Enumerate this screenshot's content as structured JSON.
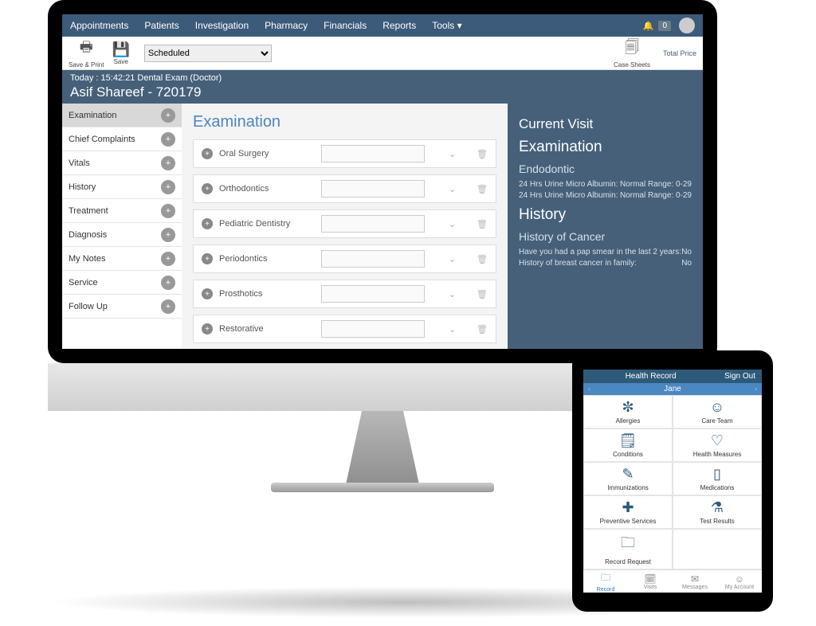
{
  "topnav": {
    "items": [
      "Appointments",
      "Patients",
      "Investigation",
      "Pharmacy",
      "Financials",
      "Reports",
      "Tools ▾"
    ],
    "notif_count": "0"
  },
  "toolbar": {
    "save_print": "Save & Print",
    "save": "Save",
    "status_value": "Scheduled",
    "case_sheets": "Case Sheets",
    "total_price_label": "Total Price"
  },
  "context": {
    "today_line": "Today : 15:42:21   Dental Exam (Doctor)",
    "patient": "Asif Shareef - 720179"
  },
  "sidebar": {
    "items": [
      {
        "label": "Examination",
        "active": true
      },
      {
        "label": "Chief Complaints"
      },
      {
        "label": "Vitals"
      },
      {
        "label": "History"
      },
      {
        "label": "Treatment"
      },
      {
        "label": "Diagnosis"
      },
      {
        "label": "My Notes"
      },
      {
        "label": "Service"
      },
      {
        "label": "Follow Up"
      }
    ]
  },
  "center": {
    "title": "Examination",
    "rows": [
      {
        "label": "Oral Surgery"
      },
      {
        "label": "Orthodontics"
      },
      {
        "label": "Pediatric Dentistry"
      },
      {
        "label": "Periodontics"
      },
      {
        "label": "Prosthotics"
      },
      {
        "label": "Restorative"
      }
    ]
  },
  "right": {
    "current_visit": "Current Visit",
    "examination": "Examination",
    "endo": "Endodontic",
    "endo_rows": [
      {
        "k": "24 Hrs Urine Micro Albumin:",
        "v": "Normal Range: 0-29"
      },
      {
        "k": "24 Hrs Urine Micro Albumin:",
        "v": "Normal Range: 0-29"
      }
    ],
    "history": "History",
    "cancer": "History of Cancer",
    "cancer_rows": [
      {
        "k": "Have you had a pap smear in the last 2 years:",
        "v": "No"
      },
      {
        "k": "History of breast cancer in family:",
        "v": "No"
      }
    ]
  },
  "tablet": {
    "header": "Health Record",
    "signout": "Sign Out",
    "patient": "Jane",
    "cells": [
      {
        "icon": "✼",
        "label": "Allergies"
      },
      {
        "icon": "☺",
        "label": "Care Team"
      },
      {
        "icon": "🗒",
        "label": "Conditions"
      },
      {
        "icon": "♡",
        "label": "Health Measures"
      },
      {
        "icon": "✎",
        "label": "Immunizations"
      },
      {
        "icon": "▯",
        "label": "Medications"
      },
      {
        "icon": "✚",
        "label": "Preventive Services"
      },
      {
        "icon": "⚗",
        "label": "Test Results"
      },
      {
        "icon": "🗀",
        "label": "Record Request"
      },
      {
        "icon": "",
        "label": ""
      }
    ],
    "footer": [
      {
        "icon": "🗀",
        "label": "Record",
        "active": true
      },
      {
        "icon": "🗓",
        "label": "Visits"
      },
      {
        "icon": "✉",
        "label": "Messages"
      },
      {
        "icon": "☺",
        "label": "My Account"
      }
    ]
  }
}
